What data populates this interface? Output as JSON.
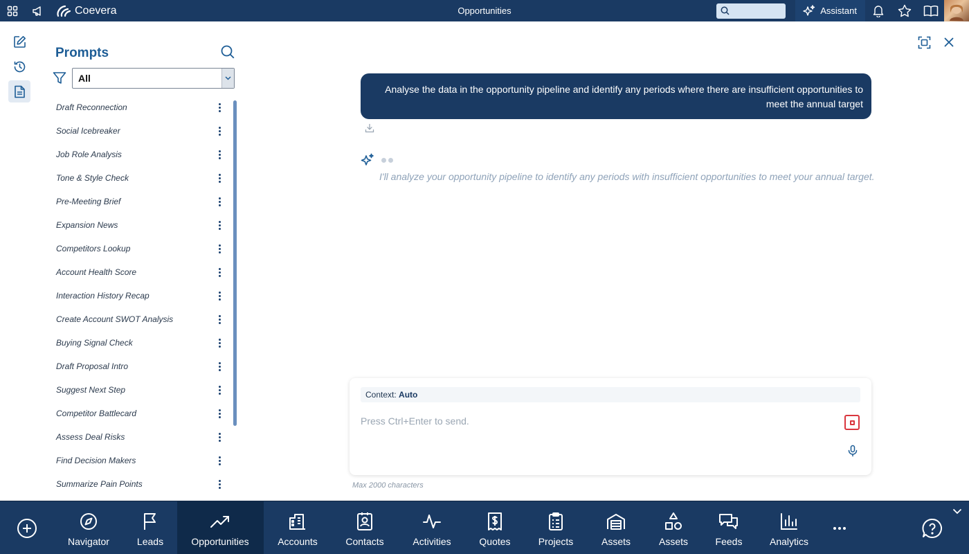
{
  "app": {
    "brand": "Coevera",
    "page_title": "Opportunities",
    "assistant_label": "Assistant",
    "search_placeholder": ""
  },
  "prompts": {
    "title": "Prompts",
    "filter_value": "All",
    "items": [
      "Draft Reconnection",
      "Social Icebreaker",
      "Job Role Analysis",
      "Tone & Style Check",
      "Pre-Meeting Brief",
      "Expansion News",
      "Competitors Lookup",
      "Account Health Score",
      "Interaction History Recap",
      "Create Account SWOT Analysis",
      "Buying Signal Check",
      "Draft Proposal Intro",
      "Suggest Next Step",
      "Competitor Battlecard",
      "Assess Deal Risks",
      "Find Decision Makers",
      "Summarize Pain Points"
    ]
  },
  "chat": {
    "user_message_line1": "Analyse the data in the opportunity pipeline and identify any periods where there are insufficient opportunities to",
    "user_message_line2": "meet the annual target",
    "ai_response": "I'll analyze your opportunity pipeline to identify any periods with insufficient opportunities to meet your annual target."
  },
  "composer": {
    "context_label": "Context:",
    "context_value": "Auto",
    "placeholder": "Press Ctrl+Enter to send.",
    "max_chars": "Max 2000 characters"
  },
  "bottom_nav": {
    "items": [
      {
        "label": "Navigator"
      },
      {
        "label": "Leads"
      },
      {
        "label": "Opportunities"
      },
      {
        "label": "Accounts"
      },
      {
        "label": "Contacts"
      },
      {
        "label": "Activities"
      },
      {
        "label": "Quotes"
      },
      {
        "label": "Projects"
      },
      {
        "label": "Assets"
      },
      {
        "label": "Assets"
      },
      {
        "label": "Feeds"
      },
      {
        "label": "Analytics"
      }
    ]
  },
  "colors": {
    "brand_navy": "#1a3a63",
    "active_nav": "#0f2a4a",
    "accent_blue": "#1d5d96",
    "stop_red": "#d9363e"
  }
}
